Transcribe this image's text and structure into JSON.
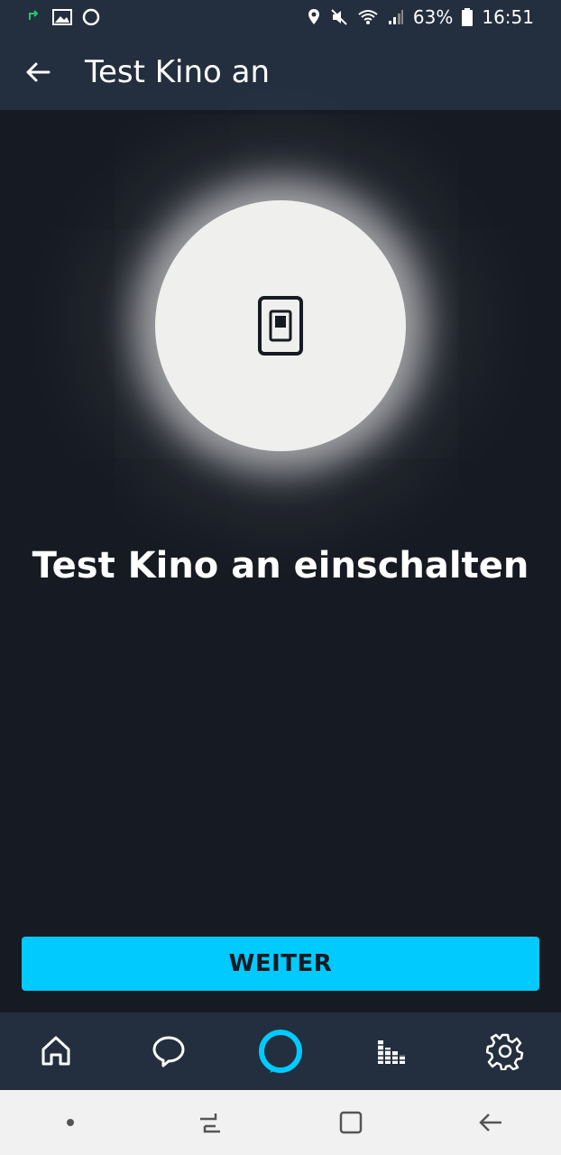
{
  "status_bar": {
    "battery": "63%",
    "time": "16:51"
  },
  "header": {
    "title": "Test Kino an"
  },
  "main": {
    "headline": "Test Kino an einschalten",
    "device_icon": "light-switch-icon"
  },
  "actions": {
    "continue_label": "WEITER"
  },
  "bottom_nav": {
    "items": [
      "home-icon",
      "chat-icon",
      "alexa-icon",
      "play-icon",
      "settings-icon"
    ]
  },
  "colors": {
    "background": "#161a22",
    "bar": "#232f3e",
    "accent": "#00caff",
    "circle": "#efefed"
  }
}
